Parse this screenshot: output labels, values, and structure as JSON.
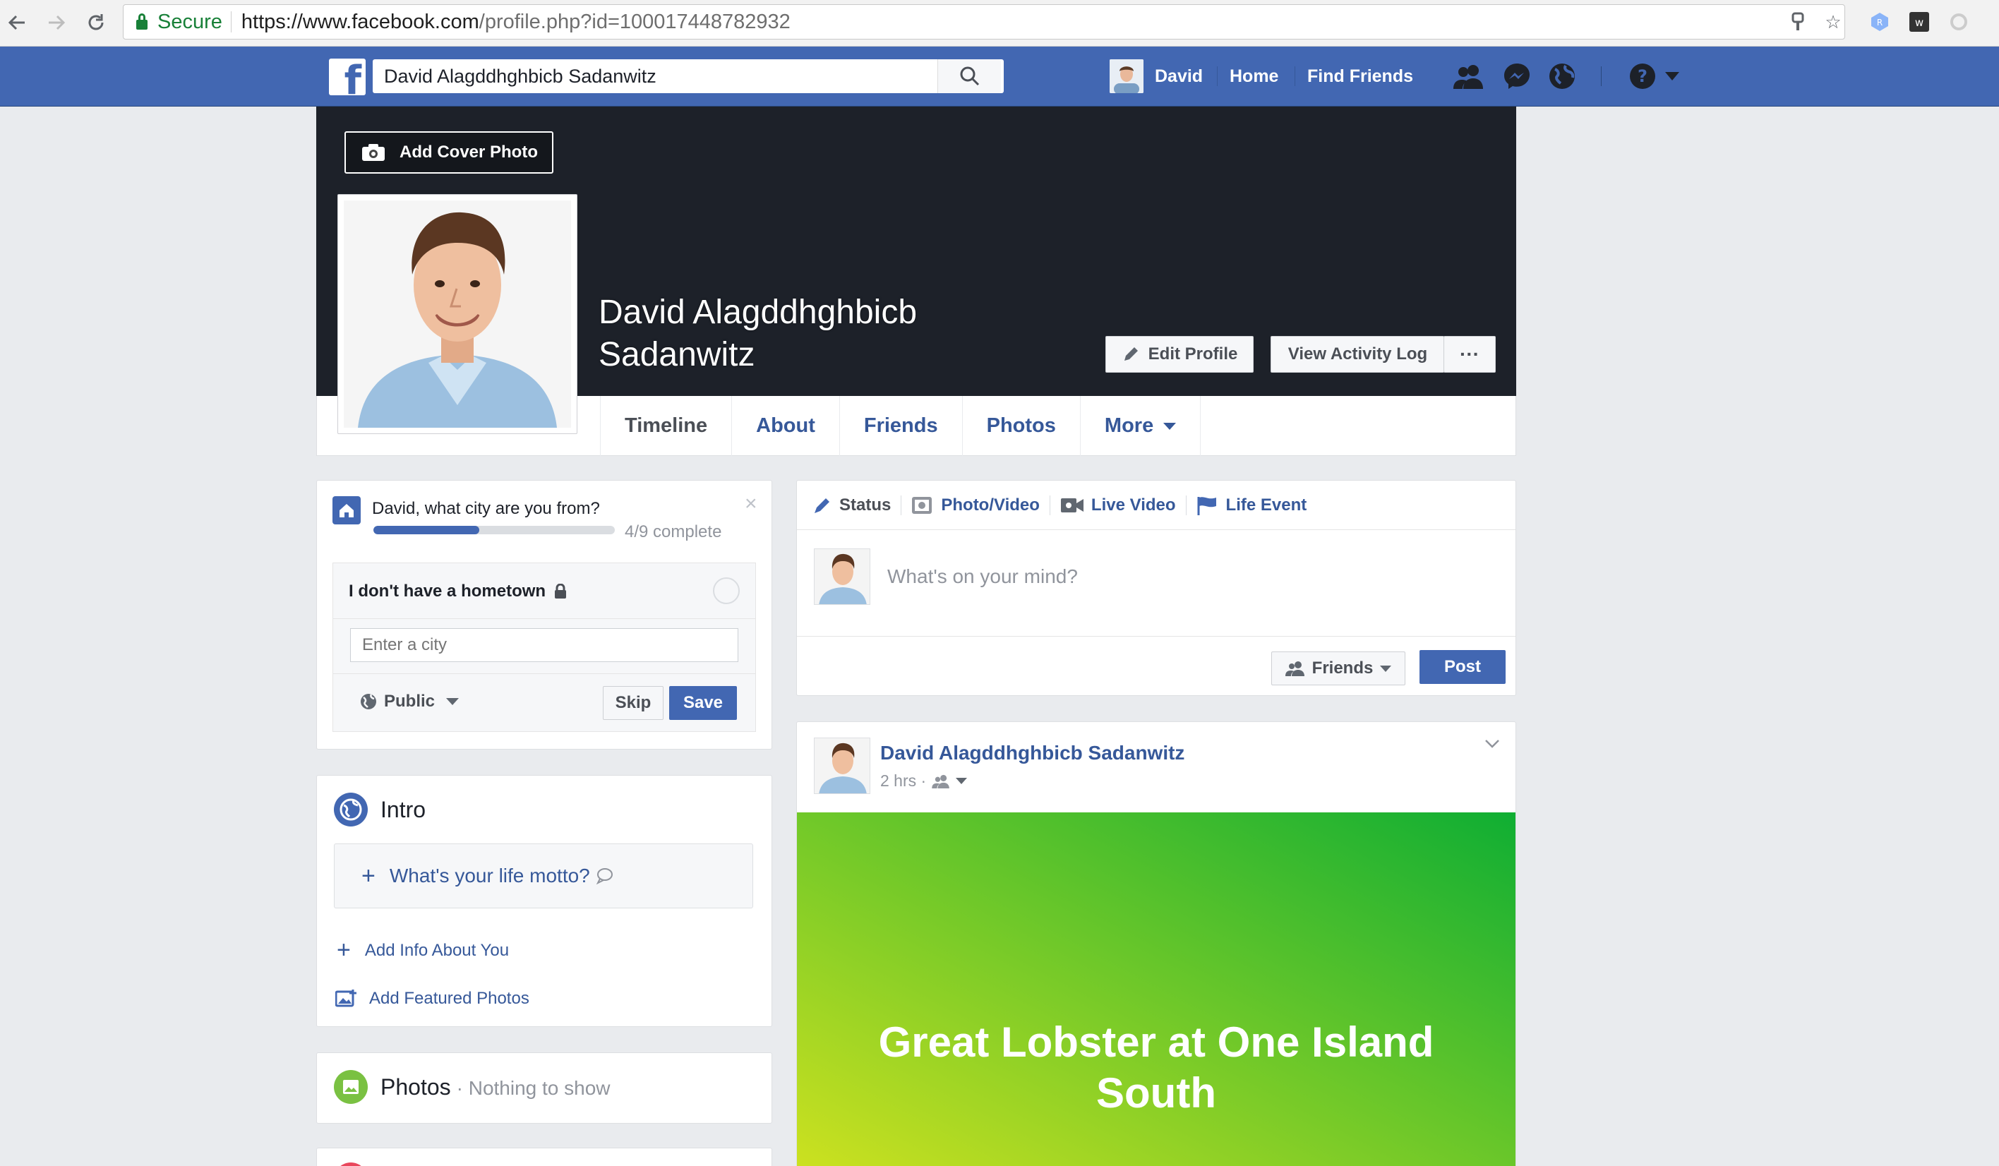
{
  "browser": {
    "secure_label": "Secure",
    "url_domain": "https://www.facebook.com",
    "url_path": "/profile.php?id=100017448782932"
  },
  "fbbar": {
    "search_value": "David Alagddhghbicb Sadanwitz",
    "user_name": "David",
    "home": "Home",
    "find_friends": "Find Friends"
  },
  "cover": {
    "add_cover_photo": "Add Cover Photo",
    "name_line1": "David Alagddhghbicb",
    "name_line2": "Sadanwitz",
    "edit_profile": "Edit Profile",
    "view_activity_log": "View Activity Log",
    "more_dots": "···"
  },
  "tabs": [
    "Timeline",
    "About",
    "Friends",
    "Photos",
    "More"
  ],
  "hometown": {
    "question": "David, what city are you from?",
    "progress_text": "4/9 complete",
    "progress_fraction": 0.44,
    "no_hometown": "I don't have a hometown",
    "city_placeholder": "Enter a city",
    "privacy": "Public",
    "skip": "Skip",
    "save": "Save"
  },
  "intro": {
    "title": "Intro",
    "motto": "What's your life motto?",
    "add_info": "Add Info About You",
    "add_featured": "Add Featured Photos"
  },
  "photos": {
    "title": "Photos",
    "subtitle": "· Nothing to show"
  },
  "composer": {
    "status": "Status",
    "photo_video": "Photo/Video",
    "live_video": "Live Video",
    "life_event": "Life Event",
    "placeholder": "What's on your mind?",
    "audience": "Friends",
    "post": "Post"
  },
  "post": {
    "author": "David Alagddhghbicb Sadanwitz",
    "time": "2 hrs ·",
    "text_line1": "Great Lobster at One Island",
    "text_line2": "South"
  },
  "colors": {
    "fb_blue": "#4267b2",
    "link_blue": "#365899",
    "cover_dark": "#1d2129",
    "post_gradient_start": "#d3e31f",
    "post_gradient_end": "#0fae33"
  }
}
